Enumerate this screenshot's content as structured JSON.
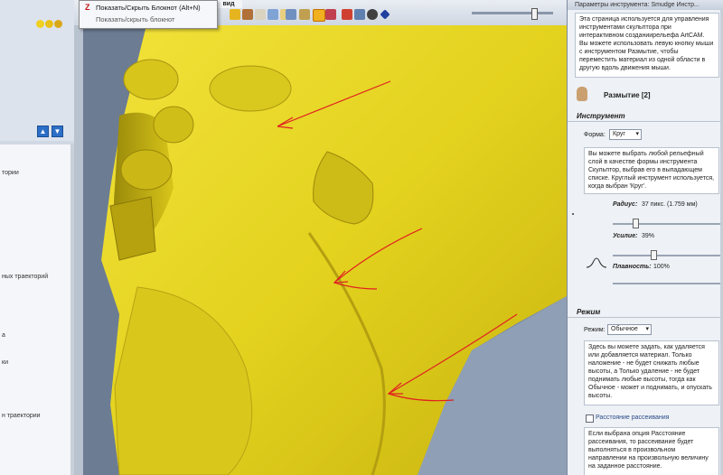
{
  "popup_menu": {
    "item1": "Показать/Скрыть Блокнот (Alt+N)",
    "item2": "Показать/скрыть блокнот"
  },
  "tabs": {
    "active": "вид"
  },
  "left_panel": {
    "items": [
      "тории",
      "",
      "",
      "",
      "",
      "ных траекторий",
      "",
      "а",
      "ки",
      "",
      "н траектории",
      ""
    ]
  },
  "right_panel": {
    "title": "Параметры инструмента: Smudge Инстр...",
    "intro": "Эта страница используется для управления инструментами скульптора при интерактивном созданиирельефа ArtCAM. Вы можете использовать левую кнопку мыши с инструментом Размытие, чтобы переместить материал из одной области в другую вдоль движения мыши.",
    "tool_name": "Размытие [2]",
    "section_tool": "Инструмент",
    "shape_label": "Форма:",
    "shape_value": "Круг",
    "shape_help": "Вы можете выбрать любой рельефный слой в качестве формы инструмента Скульптор, выбрав его в выпадающем списке. Круглый инструмент используется, когда выбран 'Круг'.",
    "radius_label": "Радиус:",
    "radius_value": "37 пикс. (1.759 мм)",
    "strength_label": "Усилие:",
    "strength_value": "39%",
    "smoothness_label": "Плавность:",
    "smoothness_value": "100%",
    "section_mode": "Режим",
    "mode_label": "Режим:",
    "mode_value": "Обычное",
    "mode_help": "Здесь вы можете задать, как удаляется или добавляется материал. Только наложение - не будет снижать любые высоты, а Только удаление - не будет поднимать любые высоты, тогда как Обычное - может и поднимать, и опускать высоты.",
    "scatter_label": "Расстояние рассеивания",
    "scatter_help": "Если выбрана опция Расстояние рассеивания, то рассеивание будет выполняться в произвольном направлении на произвольную величину на заданное расстояние."
  },
  "sliders": {
    "radius": 0.37,
    "strength": 0.39,
    "smoothness": 1.0
  },
  "colors": {
    "relief": "#e3d21e",
    "background": "#7b8ca4",
    "annotation": "#e02020"
  }
}
